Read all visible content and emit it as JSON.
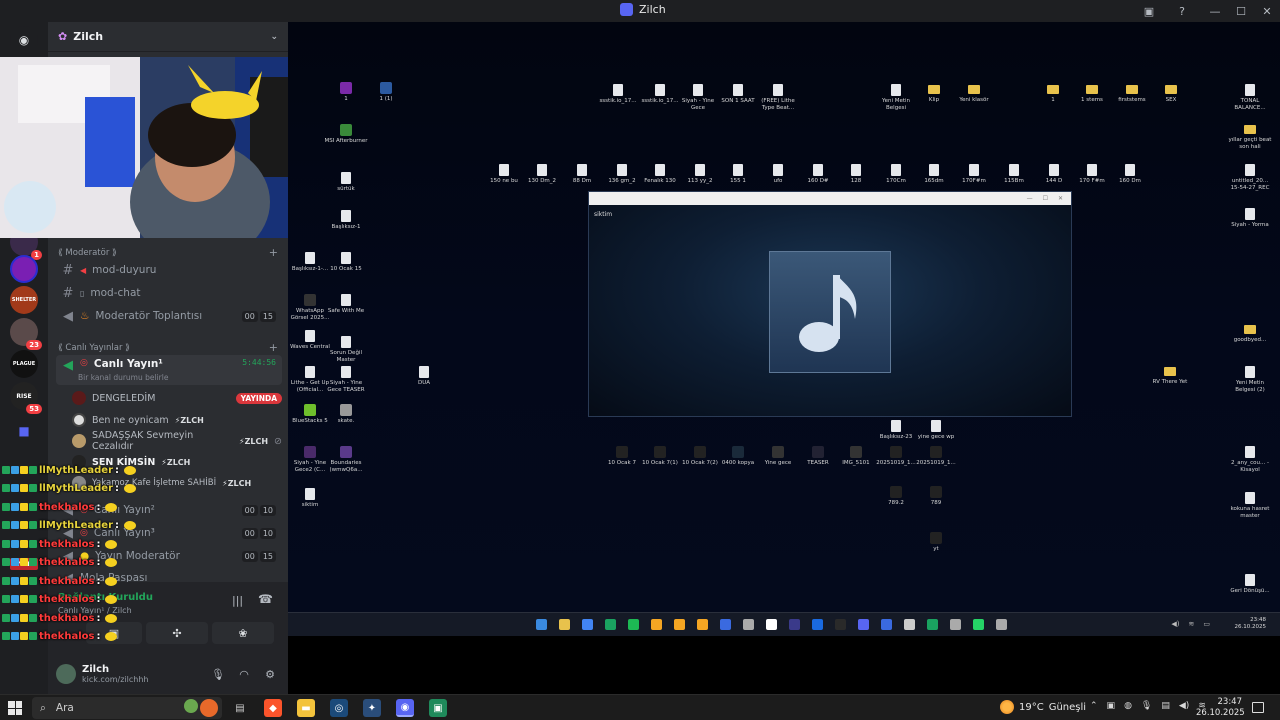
{
  "titlebar": {
    "title": "Zilch"
  },
  "discord": {
    "server_name": "Zilch",
    "server_badges": [
      "1",
      "23",
      "53"
    ],
    "partial_top": "Toplanti",
    "categories": {
      "moderator": "⟪ Moderatör ⟫",
      "live": "⟪ Canlı Yayınlar ⟫"
    },
    "channels": {
      "mod_duyuru": "mod-duyuru",
      "mod_chat": "mod-chat",
      "mod_meeting": "Moderatör Toplantısı",
      "mod_meeting_counts": [
        "00",
        "15"
      ],
      "live1": "Canlı Yayın¹",
      "live1_timer": "5:44:56",
      "live1_status": "Bir kanal durumu belirle",
      "live2": "Canlı Yayın²",
      "live2_counts": [
        "00",
        "10"
      ],
      "live3": "Canlı Yayın³",
      "live3_counts": [
        "00",
        "10"
      ],
      "stream_mod": "Yayın Moderatör",
      "stream_mod_counts": [
        "00",
        "15"
      ],
      "mola": "Mola Paspası"
    },
    "members": [
      {
        "name": "DENGELEDİM",
        "live": "YAYINDA"
      },
      {
        "name": "Ben ne oynicam",
        "tag": "ZLCH"
      },
      {
        "name": "SADAŞŞAK Sevmeyin Cezalıdır",
        "tag": "ZLCH"
      },
      {
        "name": "SEN KİMSİN",
        "tag": "ZLCH"
      },
      {
        "name": "Yakamoz Kafe İşletme SAHİBİ",
        "tag": "ZLCH"
      }
    ],
    "voice": {
      "status": "Bağlantı Kuruldu",
      "channel": "Canlı Yayın¹ / Zilch"
    },
    "user": {
      "name": "Zilch",
      "sub": "kick.com/zilchhh"
    },
    "rail_labels": {
      "shelter": "SHELTER",
      "plague": "PLAGUE",
      "rise": "RISE",
      "yeni": "YENİ",
      "biz": "BİZ"
    }
  },
  "chat": [
    {
      "user": "llMythLeader",
      "color": "#e7d33c"
    },
    {
      "user": "llMythLeader",
      "color": "#e7d33c"
    },
    {
      "user": "thekhalos",
      "color": "#ff3b3b"
    },
    {
      "user": "llMythLeader",
      "color": "#e7d33c"
    },
    {
      "user": "thekhalos",
      "color": "#ff3b3b"
    },
    {
      "user": "thekhalos",
      "color": "#ff3b3b"
    },
    {
      "user": "thekhalos",
      "color": "#ff3b3b"
    },
    {
      "user": "thekhalos",
      "color": "#ff3b3b"
    },
    {
      "user": "thekhalos",
      "color": "#ff3b3b"
    },
    {
      "user": "thekhalos",
      "color": "#ff3b3b"
    }
  ],
  "desktop": {
    "icons": [
      {
        "label": "1",
        "type": "im",
        "color": "#7a2aa8"
      },
      {
        "label": "1 (1)",
        "type": "im",
        "color": "#2c5aa0"
      },
      {
        "label": "MSI Afterburner",
        "type": "im",
        "color": "#3a8a3a"
      },
      {
        "label": "sürtük",
        "type": "gl"
      },
      {
        "label": "Başlıksız-1",
        "type": "gl"
      },
      {
        "label": "Başlıksız-1-...",
        "type": "gl"
      },
      {
        "label": "10 Ocak 15",
        "type": "gl"
      },
      {
        "label": "WhatsApp Görsel 2025...",
        "type": "im",
        "color": "#333"
      },
      {
        "label": "Safe With Me",
        "type": "gl"
      },
      {
        "label": "Waves Central",
        "type": "gl"
      },
      {
        "label": "Sorun Değil Master",
        "type": "gl"
      },
      {
        "label": "Lithe - Get Up (Official...",
        "type": "gl"
      },
      {
        "label": "Siyah - Yine Gece TEASER",
        "type": "gl"
      },
      {
        "label": "DUA",
        "type": "gl"
      },
      {
        "label": "BlueStacks 5",
        "type": "im",
        "color": "#6fbf2c"
      },
      {
        "label": "skate.",
        "type": "im",
        "color": "#999"
      },
      {
        "label": "Siyah - Yine Gece2 (C...",
        "type": "im",
        "color": "#4a2a6a"
      },
      {
        "label": "Boundaries (wmwQ6a...",
        "type": "im",
        "color": "#5a3a8a"
      },
      {
        "label": "siktim",
        "type": "gl"
      },
      {
        "label": "ssstik.io_17...",
        "type": "gl"
      },
      {
        "label": "ssstik.io_17...",
        "type": "gl"
      },
      {
        "label": "Siyah - Yine Gece",
        "type": "gl"
      },
      {
        "label": "SON 1 SAAT",
        "type": "gl"
      },
      {
        "label": "(FREE) Lithe Type Beat...",
        "type": "gl"
      },
      {
        "label": "Yeni Metin Belgesi",
        "type": "gl"
      },
      {
        "label": "Klip",
        "type": "fd"
      },
      {
        "label": "Yeni klasör",
        "type": "fd"
      },
      {
        "label": "1",
        "type": "fd"
      },
      {
        "label": "1 stems",
        "type": "fd"
      },
      {
        "label": "firststems",
        "type": "fd"
      },
      {
        "label": "SEX",
        "type": "fd"
      },
      {
        "label": "TONAL BALANCE...",
        "type": "gl"
      },
      {
        "label": "yıllar geçti beat son hali",
        "type": "fd"
      },
      {
        "label": "untitled_20... 15-54-27_REC",
        "type": "gl"
      },
      {
        "label": "Siyah - Yorma",
        "type": "gl"
      },
      {
        "label": "goodbyed...",
        "type": "fd"
      },
      {
        "label": "RV There Yet",
        "type": "fd"
      },
      {
        "label": "Yeni Metin Belgesi (2)",
        "type": "gl"
      },
      {
        "label": "2_any_cou... - Kisayol",
        "type": "gl"
      },
      {
        "label": "kokuna hasret master",
        "type": "gl"
      },
      {
        "label": "Geri Dönüşü...",
        "type": "gl"
      },
      {
        "label": "150 ne bu",
        "type": "gl"
      },
      {
        "label": "130 Dm_2",
        "type": "gl"
      },
      {
        "label": "88 Dm",
        "type": "gl"
      },
      {
        "label": "136 gm_2",
        "type": "gl"
      },
      {
        "label": "Fenalık 130",
        "type": "gl"
      },
      {
        "label": "113 yy_2",
        "type": "gl"
      },
      {
        "label": "155 1",
        "type": "gl"
      },
      {
        "label": "ufo",
        "type": "gl"
      },
      {
        "label": "160 D#",
        "type": "gl"
      },
      {
        "label": "128",
        "type": "gl"
      },
      {
        "label": "170Cm",
        "type": "gl"
      },
      {
        "label": "165dm",
        "type": "gl"
      },
      {
        "label": "170F#m",
        "type": "gl"
      },
      {
        "label": "115Bm",
        "type": "gl"
      },
      {
        "label": "144 D",
        "type": "gl"
      },
      {
        "label": "170 F#m",
        "type": "gl"
      },
      {
        "label": "160 Dm",
        "type": "gl"
      },
      {
        "label": "Başlıksız-23",
        "type": "gl"
      },
      {
        "label": "yine gece wp",
        "type": "gl"
      },
      {
        "label": "10 Ocak 7",
        "type": "im",
        "color": "#222"
      },
      {
        "label": "10 Ocak 7(1)",
        "type": "im",
        "color": "#222"
      },
      {
        "label": "10 Ocak 7(2)",
        "type": "im",
        "color": "#222"
      },
      {
        "label": "0400 kopya",
        "type": "im",
        "color": "#1a2a3a"
      },
      {
        "label": "Yine gece",
        "type": "im",
        "color": "#333"
      },
      {
        "label": "TEASER",
        "type": "im",
        "color": "#223"
      },
      {
        "label": "IMG_5101",
        "type": "im",
        "color": "#333"
      },
      {
        "label": "20251019_1...",
        "type": "im",
        "color": "#222"
      },
      {
        "label": "20251019_1...",
        "type": "im",
        "color": "#222"
      },
      {
        "label": "789.2",
        "type": "im",
        "color": "#222"
      },
      {
        "label": "789",
        "type": "im",
        "color": "#222"
      },
      {
        "label": "yt",
        "type": "im",
        "color": "#222"
      }
    ],
    "player": {
      "label": "siktim"
    },
    "inner_clock": {
      "time": "23:48",
      "date": "26.10.2025"
    }
  },
  "taskbar": {
    "search_placeholder": "Ara",
    "weather": {
      "temp": "19°C",
      "cond": "Güneşli"
    },
    "clock": {
      "time": "23:47",
      "date": "26.10.2025"
    }
  }
}
